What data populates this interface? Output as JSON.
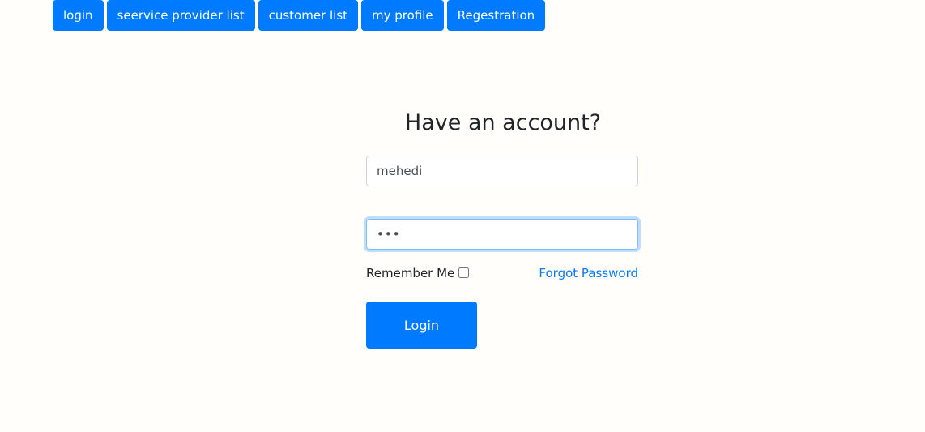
{
  "nav": {
    "items": [
      {
        "label": "login"
      },
      {
        "label": "seervice provider list"
      },
      {
        "label": "customer list"
      },
      {
        "label": "my profile"
      },
      {
        "label": "Regestration"
      }
    ]
  },
  "form": {
    "title": "Have an account?",
    "username_value": "mehedi",
    "password_value": "•••",
    "remember_label": "Remember Me",
    "forgot_label": "Forgot Password",
    "submit_label": "Login"
  },
  "colors": {
    "primary": "#007bff",
    "background": "#fffefb"
  }
}
